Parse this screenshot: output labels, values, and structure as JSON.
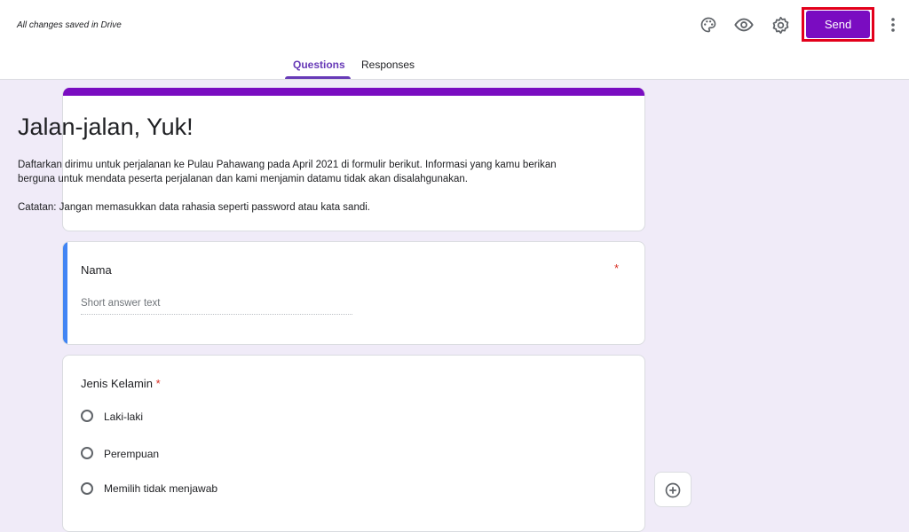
{
  "header": {
    "save_status": "All changes saved in Drive",
    "send_label": "Send",
    "icons": [
      "palette-icon",
      "eye-icon",
      "gear-icon",
      "more-vert-icon"
    ],
    "accent_color": "#7a0cc1"
  },
  "tabs": [
    {
      "label": "Questions",
      "active": true
    },
    {
      "label": "Responses",
      "active": false
    }
  ],
  "form": {
    "title": "Jalan-jalan, Yuk!",
    "description_line1": "Daftarkan dirimu untuk perjalanan ke Pulau Pahawang pada April 2021 di formulir berikut. Informasi yang kamu berikan berguna untuk mendata peserta perjalanan dan kami menjamin datamu tidak akan disalahgunakan.",
    "description_line2": "Catatan: Jangan memasukkan data rahasia seperti password atau kata sandi."
  },
  "questions": [
    {
      "title": "Nama",
      "required_mark": "*",
      "placeholder": "Short answer text"
    },
    {
      "title": "Jenis Kelamin",
      "required_mark": "*",
      "options": [
        "Laki-laki",
        "Perempuan",
        "Memilih tidak menjawab"
      ]
    }
  ]
}
